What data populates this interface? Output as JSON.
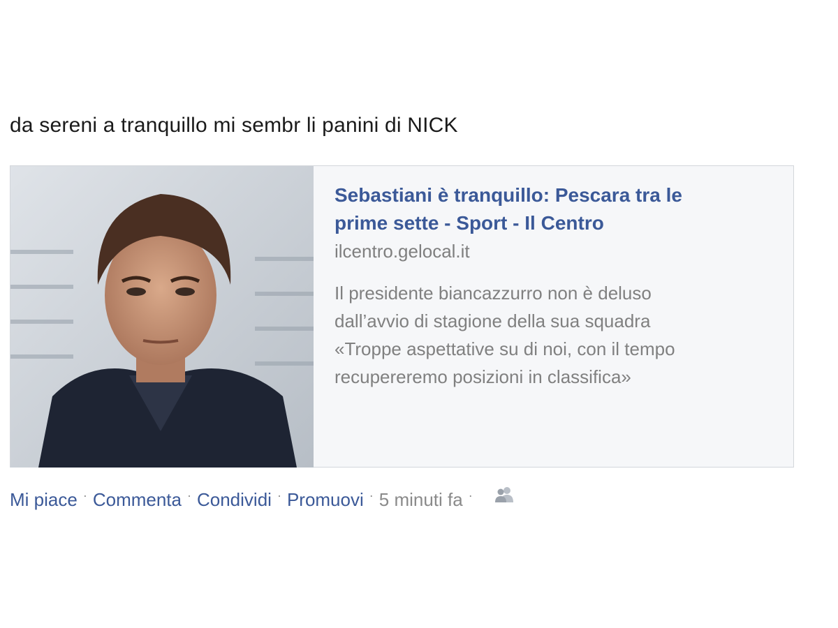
{
  "post": {
    "message": "da sereni a tranquillo mi sembr li panini di NICK"
  },
  "link_preview": {
    "title_line1": "Sebastiani è tranquillo: Pescara tra le",
    "title_line2": "prime sette - Sport - Il Centro",
    "domain": "ilcentro.gelocal.it",
    "description_lines": [
      "Il presidente biancazzurro non è deluso",
      "dall’avvio di stagione della sua squadra",
      "«Troppe aspettative su di noi, con il tempo",
      "recupereremo posizioni in classifica»"
    ],
    "thumbnail_icon": "portrait-photo"
  },
  "actions": {
    "like": "Mi piace",
    "comment": "Commenta",
    "share": "Condividi",
    "promote": "Promuovi",
    "separator": "·",
    "timestamp": "5 minuti fa",
    "audience_icon": "friends-icon"
  },
  "colors": {
    "link": "#3b5998",
    "muted": "#808080",
    "card_bg": "#f6f7f9",
    "card_border": "#d3d6db"
  }
}
